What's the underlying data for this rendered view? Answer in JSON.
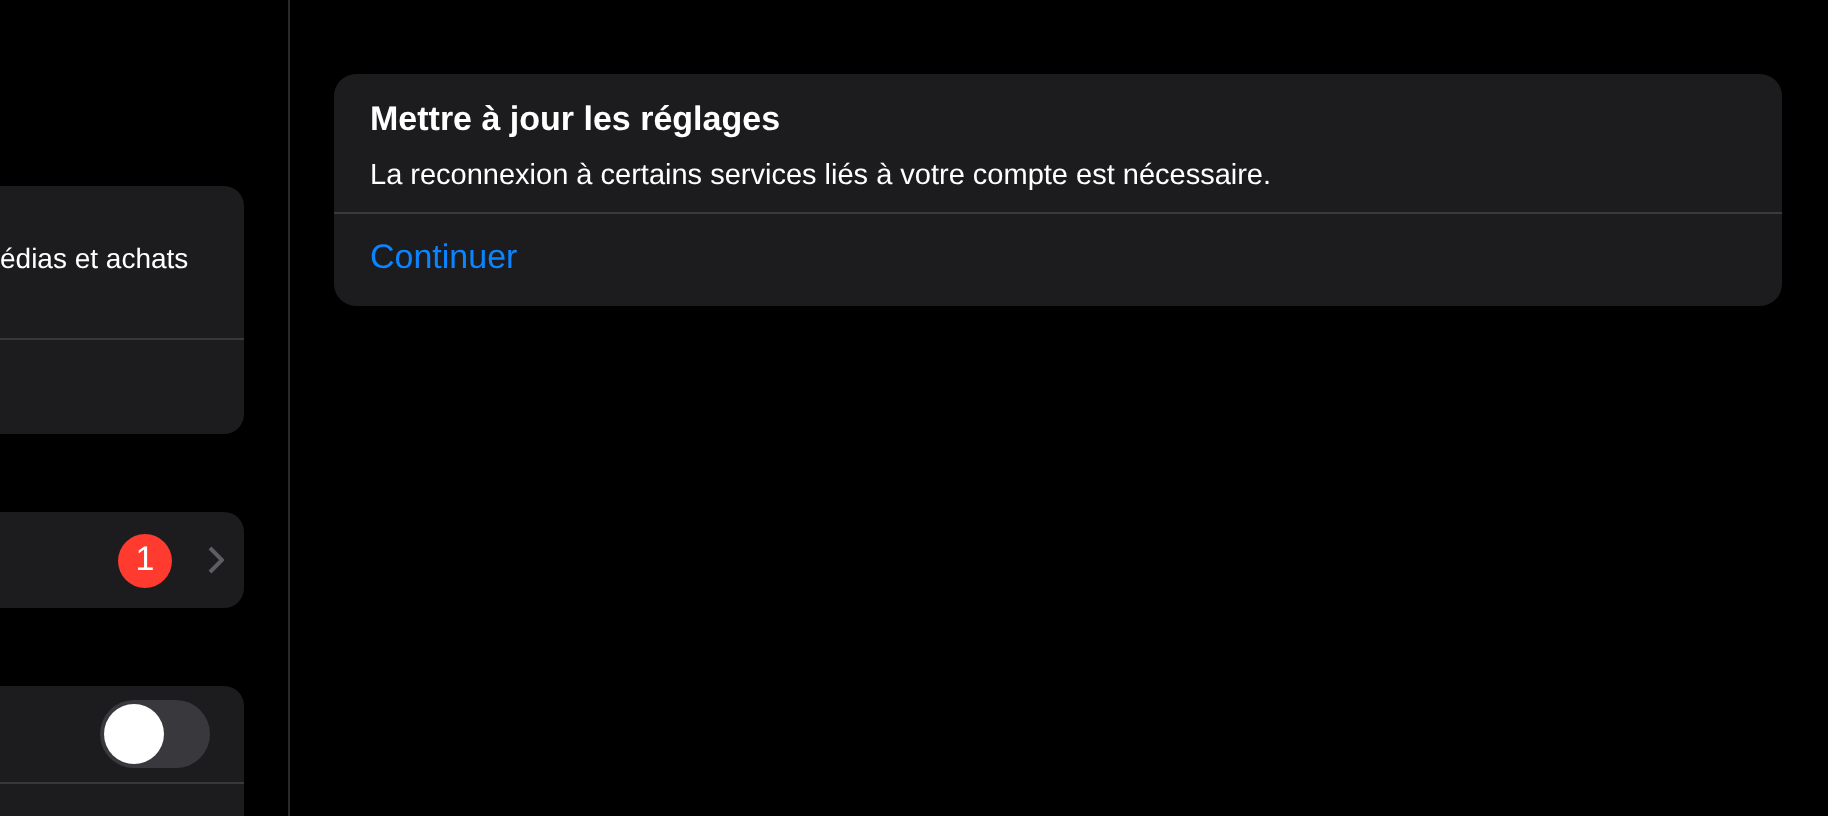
{
  "sidebar": {
    "groups": [
      {
        "rows": [
          {
            "kind": "text",
            "label": "édias et achats"
          },
          {
            "kind": "empty"
          }
        ]
      },
      {
        "rows": [
          {
            "kind": "badge",
            "badge": "1"
          }
        ]
      },
      {
        "rows": [
          {
            "kind": "toggle",
            "on": false
          },
          {
            "kind": "empty"
          }
        ]
      }
    ]
  },
  "alert": {
    "title": "Mettre à jour les réglages",
    "message": "La reconnexion à certains services liés à votre compte est nécessaire.",
    "action": "Continuer"
  }
}
